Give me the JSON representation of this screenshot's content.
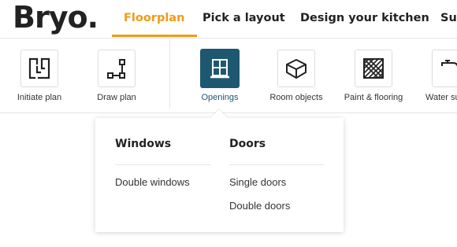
{
  "header": {
    "logo": "Bryo.",
    "tabs": [
      {
        "label": "Floorplan",
        "active": true
      },
      {
        "label": "Pick a layout"
      },
      {
        "label": "Design your kitchen"
      },
      {
        "label": "Sur"
      }
    ],
    "accent_color": "#f29a16"
  },
  "tools": [
    {
      "label": "Initiate plan",
      "icon": "floorplan-icon"
    },
    {
      "label": "Draw plan",
      "icon": "draw-line-icon"
    },
    {
      "label": "Openings",
      "icon": "window-icon",
      "active": true
    },
    {
      "label": "Room objects",
      "icon": "cube-icon"
    },
    {
      "label": "Paint & flooring",
      "icon": "floor-pattern-icon"
    },
    {
      "label": "Water su",
      "icon": "faucet-icon"
    }
  ],
  "active_color": "#1e5770",
  "openings_menu": {
    "windows": {
      "title": "Windows",
      "items": [
        "Double windows"
      ]
    },
    "doors": {
      "title": "Doors",
      "items": [
        "Single doors",
        "Double doors"
      ]
    }
  }
}
